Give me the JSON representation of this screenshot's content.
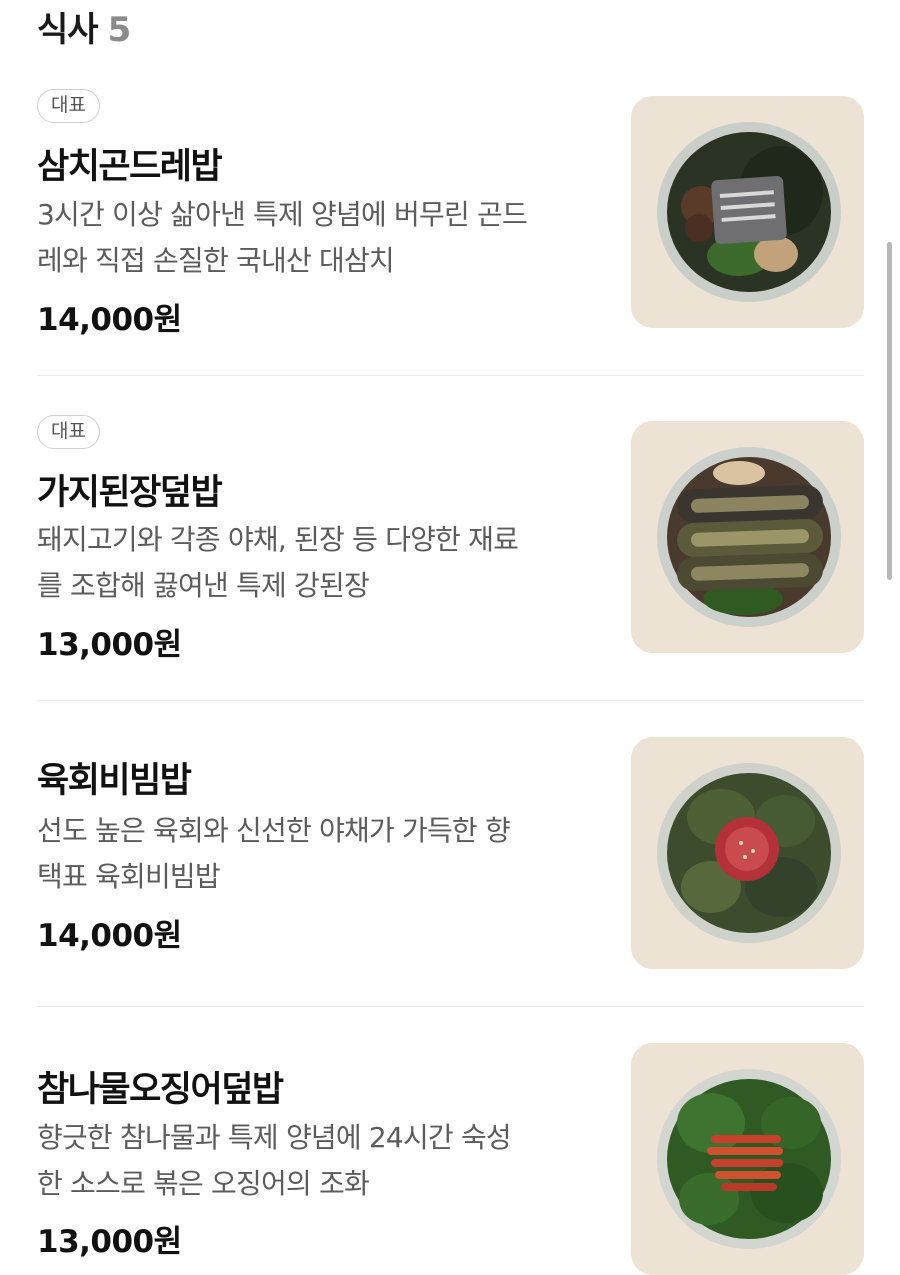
{
  "section": {
    "title": "식사",
    "count": "5"
  },
  "items": [
    {
      "badge": "대표",
      "name": "삼치곤드레밥",
      "desc_line1": "3시간 이상 삶아낸 특제 양념에 버무린 곤드",
      "desc_line2": "레와 직접 손질한 국내산 대삼치",
      "price": "14,000원",
      "photo_icon": "samchi-gondre-bap-photo"
    },
    {
      "badge": "대표",
      "name": "가지된장덮밥",
      "desc_line1": "돼지고기와 각종 야채, 된장 등 다양한 재료",
      "desc_line2": "를 조합해 끓여낸 특제 강된장",
      "price": "13,000원",
      "photo_icon": "eggplant-doenjang-bowl-photo"
    },
    {
      "name": "육회비빔밥",
      "desc_line1": "선도 높은 육회와 신선한 야채가 가득한 향",
      "desc_line2": "택표 육회비빔밥",
      "price": "14,000원",
      "photo_icon": "yukhoe-bibimbap-photo"
    },
    {
      "name": "참나물오징어덮밥",
      "desc_line1": "향긋한 참나물과 특제 양념에 24시간 숙성",
      "desc_line2": "한 소스로 볶은 오징어의 조화",
      "price": "13,000원",
      "photo_icon": "chamnamul-squid-bowl-photo"
    }
  ],
  "colors": {
    "photo_bg": "#ece3d4",
    "badge_border": "#cfcfcf",
    "count": "#8b8b8b",
    "desc": "#5c5c5c"
  }
}
